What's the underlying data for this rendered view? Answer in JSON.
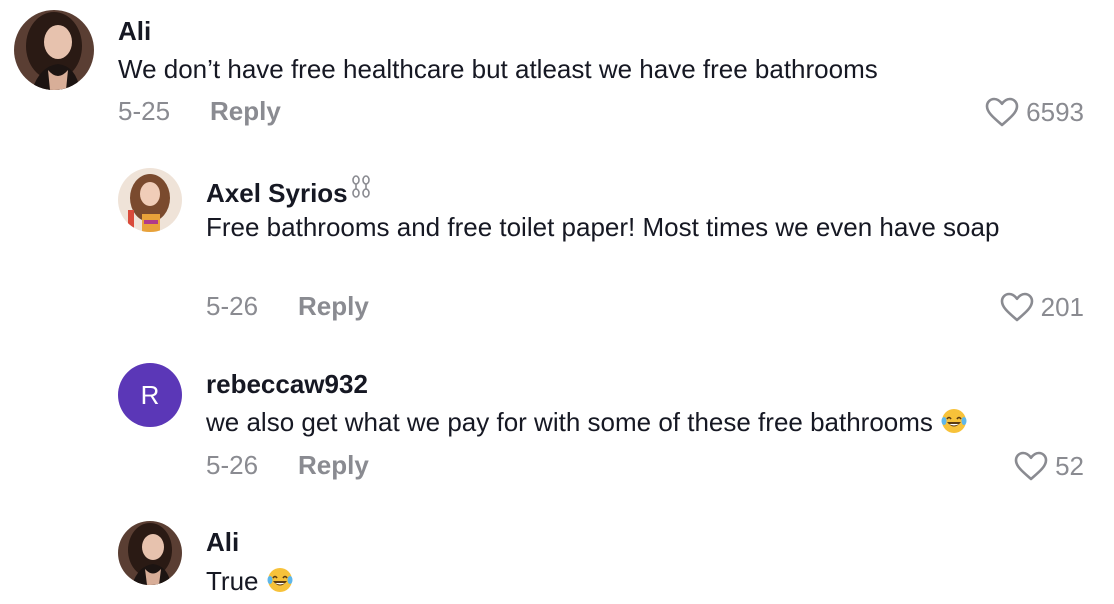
{
  "comments": [
    {
      "username": "Ali",
      "text": "We don’t have free healthcare but atleast we have free bathrooms",
      "date": "5-25",
      "reply_label": "Reply",
      "likes": "6593",
      "avatar_icon": "photo-avatar-dark-hair"
    },
    {
      "username": "Axel Syrios",
      "username_badge_icon": "chain-link-icon",
      "text": "Free bathrooms and free toilet paper! Most times we even have soap",
      "date": "5-26",
      "reply_label": "Reply",
      "likes": "201",
      "avatar_icon": "photo-avatar-long-hair"
    },
    {
      "username": "rebeccaw932",
      "text": "we also get what we pay for with some of these free bathrooms",
      "text_emoji": "laughing-tears-emoji",
      "date": "5-26",
      "reply_label": "Reply",
      "likes": "52",
      "avatar_letter": "R",
      "avatar_color": "#5b37b7"
    },
    {
      "username": "Ali",
      "text": "True",
      "text_emoji": "laughing-tears-emoji",
      "avatar_icon": "photo-avatar-dark-hair"
    }
  ],
  "colors": {
    "primary_text": "#161823",
    "secondary_text": "#8a8b91",
    "avatar_purple": "#5b37b7"
  }
}
